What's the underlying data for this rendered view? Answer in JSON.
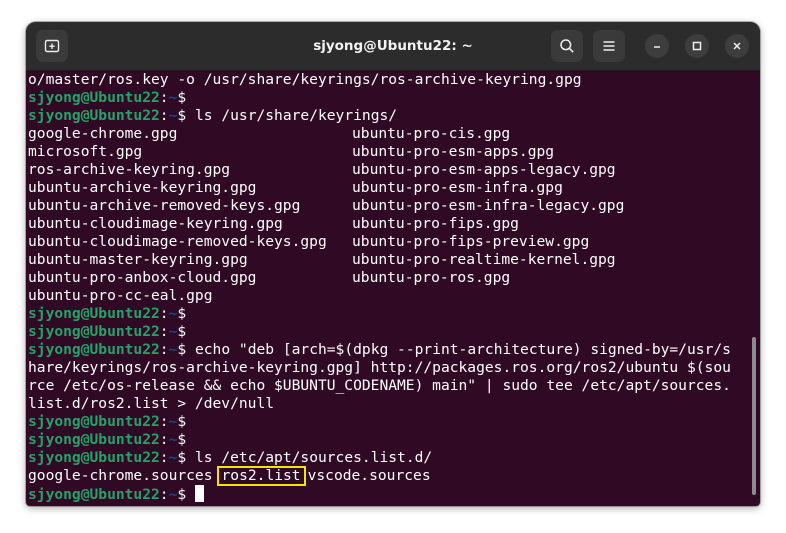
{
  "window": {
    "title": "sjyong@Ubuntu22: ~"
  },
  "prompt": {
    "user": "sjyong@Ubuntu22",
    "sep": ":",
    "path": "~",
    "sign": "$"
  },
  "lines": [
    {
      "text": "o/master/ros.key -o /usr/share/keyrings/ros-archive-keyring.gpg"
    },
    {
      "cmd": ""
    },
    {
      "cmd": " ls /usr/share/keyrings/"
    },
    {
      "left": "google-chrome.gpg",
      "right": "ubuntu-pro-cis.gpg"
    },
    {
      "left": "microsoft.gpg",
      "right": "ubuntu-pro-esm-apps.gpg"
    },
    {
      "left": "ros-archive-keyring.gpg",
      "right": "ubuntu-pro-esm-apps-legacy.gpg"
    },
    {
      "left": "ubuntu-archive-keyring.gpg",
      "right": "ubuntu-pro-esm-infra.gpg"
    },
    {
      "left": "ubuntu-archive-removed-keys.gpg",
      "right": "ubuntu-pro-esm-infra-legacy.gpg"
    },
    {
      "left": "ubuntu-cloudimage-keyring.gpg",
      "right": "ubuntu-pro-fips.gpg"
    },
    {
      "left": "ubuntu-cloudimage-removed-keys.gpg",
      "right": "ubuntu-pro-fips-preview.gpg"
    },
    {
      "left": "ubuntu-master-keyring.gpg",
      "right": "ubuntu-pro-realtime-kernel.gpg"
    },
    {
      "left": "ubuntu-pro-anbox-cloud.gpg",
      "right": "ubuntu-pro-ros.gpg"
    },
    {
      "left": "ubuntu-pro-cc-eal.gpg",
      "right": ""
    },
    {
      "cmd": ""
    },
    {
      "cmd": ""
    },
    {
      "cmd": " echo \"deb [arch=$(dpkg --print-architecture) signed-by=/usr/s"
    },
    {
      "text": "hare/keyrings/ros-archive-keyring.gpg] http://packages.ros.org/ros2/ubuntu $(sou"
    },
    {
      "text": "rce /etc/os-release && echo $UBUNTU_CODENAME) main\" | sudo tee /etc/apt/sources."
    },
    {
      "text": "list.d/ros2.list > /dev/null"
    },
    {
      "cmd": ""
    },
    {
      "cmd": ""
    },
    {
      "cmd": " ls /etc/apt/sources.list.d/"
    }
  ],
  "sources_listing": {
    "first": "google-chrome.sources",
    "highlighted": "ros2.list",
    "last": "vscode.sources"
  },
  "colors": {
    "terminal_bg": "#300a24",
    "prompt_user": "#26a269",
    "prompt_path": "#12488b",
    "highlight_box": "#f5e400"
  }
}
